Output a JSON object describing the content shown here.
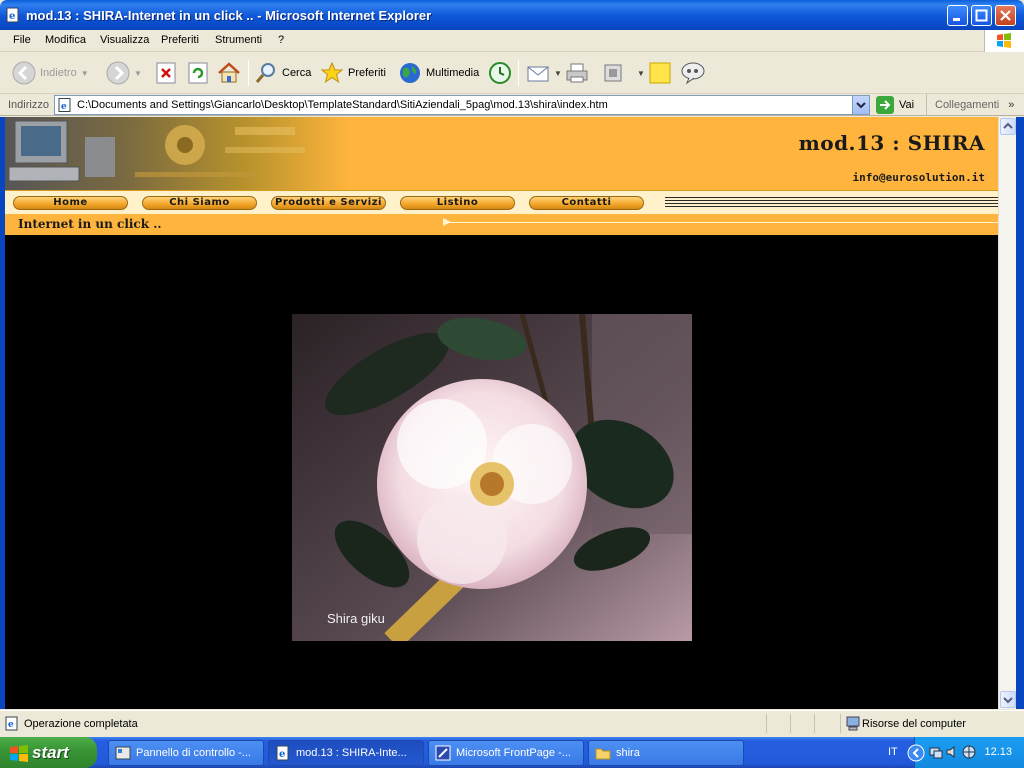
{
  "window": {
    "title": "mod.13 : SHIRA-Internet in un click .. - Microsoft Internet Explorer"
  },
  "menu": [
    "File",
    "Modifica",
    "Visualizza",
    "Preferiti",
    "Strumenti",
    "?"
  ],
  "toolbar": {
    "back": "Indietro",
    "search": "Cerca",
    "favorites": "Preferiti",
    "media": "Multimedia"
  },
  "address": {
    "label": "Indirizzo",
    "url": "C:\\Documents and Settings\\Giancarlo\\Desktop\\TemplateStandard\\SitiAziendali_5pag\\mod.13\\shira\\index.htm",
    "go": "Vai",
    "links": "Collegamenti"
  },
  "site": {
    "title": "mod.13 : SHIRA",
    "email": "info@eurosolution.it",
    "nav": [
      "Home",
      "Chi Siamo",
      "Prodotti e Servizi",
      "Listino",
      "Contatti"
    ],
    "tagline": "Internet in un click ..",
    "photo_caption": "Shira giku"
  },
  "status": {
    "message": "Operazione completata",
    "zone": "Risorse del computer"
  },
  "taskbar": {
    "start": "start",
    "tasks": [
      "Pannello di controllo -...",
      "mod.13 : SHIRA-Inte...",
      "Microsoft FrontPage -...",
      "shira"
    ],
    "lang": "IT",
    "clock": "12.13"
  }
}
